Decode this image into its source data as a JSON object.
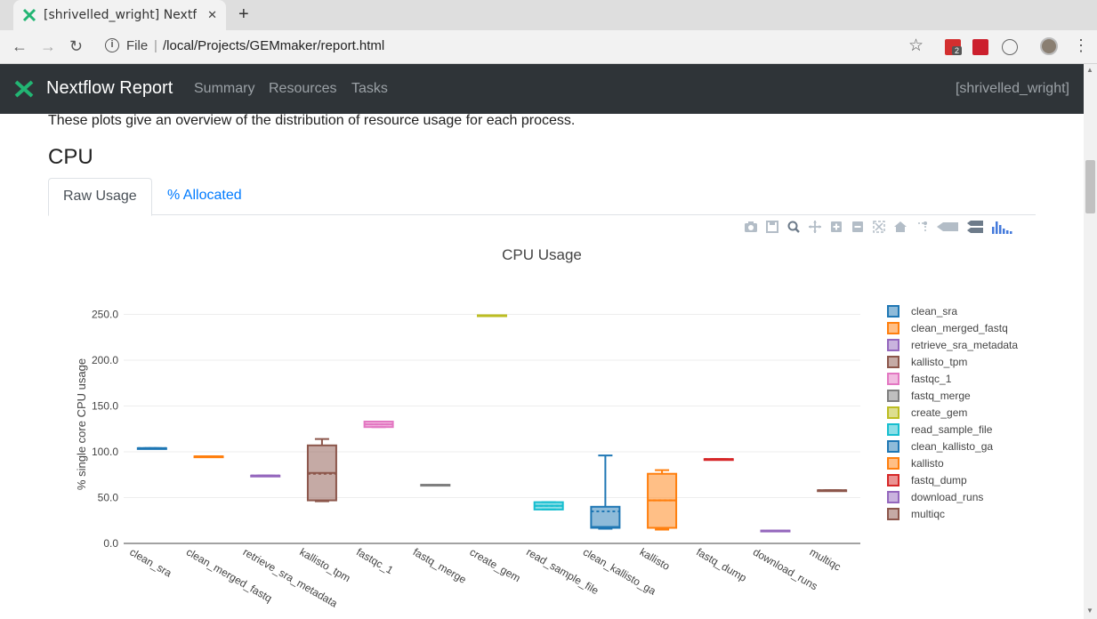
{
  "browser": {
    "tab_title": "[shrivelled_wright] Nextflow Report",
    "new_tab_symbol": "+",
    "file_label": "File",
    "url": "/local/Projects/GEMmaker/report.html",
    "extension_badge": "2"
  },
  "navbar": {
    "brand": "Nextflow Report",
    "links": [
      "Summary",
      "Resources",
      "Tasks"
    ],
    "run_name": "[shrivelled_wright]"
  },
  "content": {
    "intro": "These plots give an overview of the distribution of resource usage for each process.",
    "section_title": "CPU",
    "tabs": [
      "Raw Usage",
      "% Allocated"
    ]
  },
  "modebar_icons": [
    "camera-icon",
    "save-icon",
    "zoom-icon",
    "pan-icon",
    "zoom-in-icon",
    "zoom-out-icon",
    "autoscale-icon",
    "home-icon",
    "spike-lines-icon",
    "hover-closest-icon",
    "hover-compare-icon",
    "plotly-logo-icon"
  ],
  "chart_data": {
    "type": "box",
    "title": "CPU Usage",
    "ylabel": "% single core CPU usage",
    "xlabel": "",
    "ylim": [
      0,
      260
    ],
    "yticks": [
      "0.0",
      "50.0",
      "100.0",
      "150.0",
      "200.0",
      "250.0"
    ],
    "grid": true,
    "legend_position": "right",
    "series": [
      {
        "name": "clean_sra",
        "color": "#1f77b4",
        "min": 104,
        "q1": 104,
        "median": 104,
        "mean": 104,
        "q3": 104,
        "max": 104
      },
      {
        "name": "clean_merged_fastq",
        "color": "#ff7f0e",
        "min": 95,
        "q1": 95,
        "median": 95,
        "mean": 95,
        "q3": 95,
        "max": 95
      },
      {
        "name": "retrieve_sra_metadata",
        "color": "#9467bd",
        "min": 74,
        "q1": 74,
        "median": 74,
        "mean": 74,
        "q3": 74,
        "max": 74
      },
      {
        "name": "kallisto_tpm",
        "color": "#8c564b",
        "min": 46,
        "q1": 47,
        "median": 77,
        "mean": 76,
        "q3": 107,
        "max": 114
      },
      {
        "name": "fastqc_1",
        "color": "#e377c2",
        "min": 127,
        "q1": 127,
        "median": 130,
        "mean": 130,
        "q3": 133,
        "max": 133
      },
      {
        "name": "fastq_merge",
        "color": "#7f7f7f",
        "min": 64,
        "q1": 64,
        "median": 64,
        "mean": 64,
        "q3": 64,
        "max": 64
      },
      {
        "name": "create_gem",
        "color": "#bcbd22",
        "min": 249,
        "q1": 249,
        "median": 249,
        "mean": 249,
        "q3": 249,
        "max": 249
      },
      {
        "name": "read_sample_file",
        "color": "#17becf",
        "min": 37,
        "q1": 37,
        "median": 41,
        "mean": 41,
        "q3": 45,
        "max": 45
      },
      {
        "name": "clean_kallisto_ga",
        "color": "#1f77b4",
        "min": 16,
        "q1": 17,
        "median": 18,
        "mean": 35,
        "q3": 40,
        "max": 96
      },
      {
        "name": "kallisto",
        "color": "#ff7f0e",
        "min": 15,
        "q1": 17,
        "median": 47,
        "mean": 47,
        "q3": 76,
        "max": 80
      },
      {
        "name": "fastq_dump",
        "color": "#d62728",
        "min": 92,
        "q1": 92,
        "median": 92,
        "mean": 92,
        "q3": 92,
        "max": 92
      },
      {
        "name": "download_runs",
        "color": "#9467bd",
        "min": 14,
        "q1": 14,
        "median": 14,
        "mean": 14,
        "q3": 14,
        "max": 14
      },
      {
        "name": "multiqc",
        "color": "#8c564b",
        "min": 58,
        "q1": 58,
        "median": 58,
        "mean": 58,
        "q3": 58,
        "max": 58
      }
    ]
  }
}
